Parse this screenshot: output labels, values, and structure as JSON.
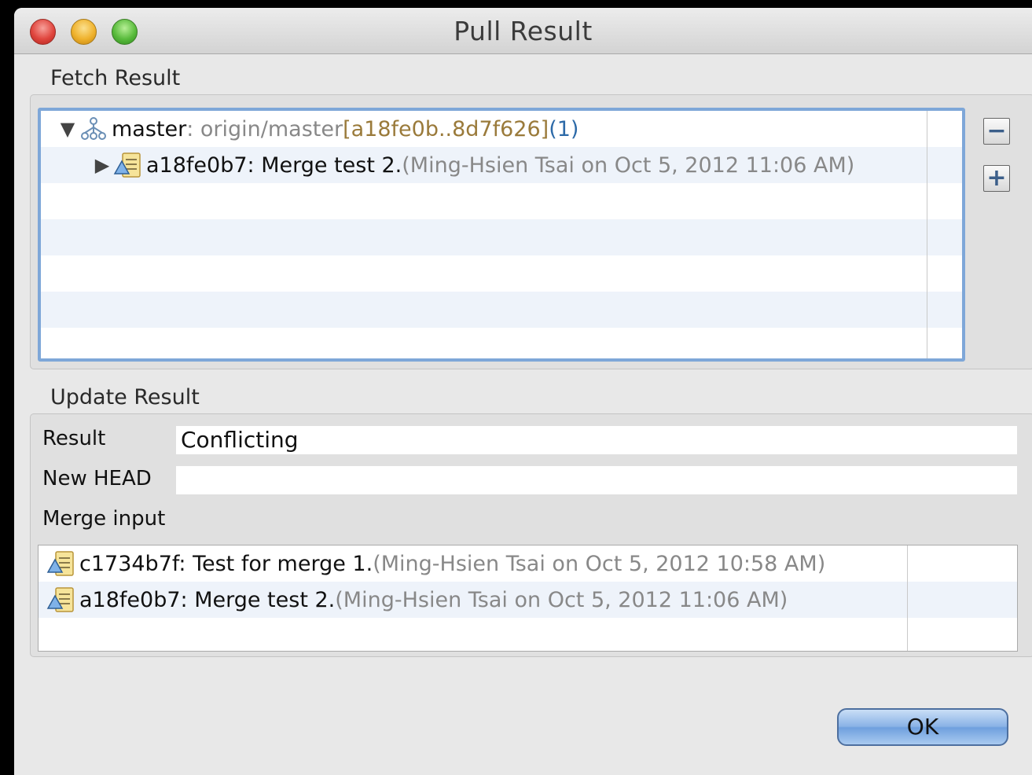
{
  "window": {
    "title": "Pull Result"
  },
  "fetch_result": {
    "label": "Fetch Result",
    "root": {
      "name": "master",
      "sep": " : origin/master ",
      "range": "[a18fe0b..8d7f626]",
      "count": " (1)"
    },
    "commit": {
      "id_msg": "a18fe0b7: Merge test 2.",
      "meta": " (Ming-Hsien Tsai on Oct 5, 2012 11:06 AM)"
    }
  },
  "update_result": {
    "label": "Update Result",
    "result_label": "Result",
    "result_value": "Conflicting",
    "new_head_label": "New HEAD",
    "new_head_value": "",
    "merge_input_label": "Merge input",
    "merge_inputs": [
      {
        "id_msg": "c1734b7f: Test for merge 1.",
        "meta": " (Ming-Hsien Tsai on Oct 5, 2012 10:58 AM)"
      },
      {
        "id_msg": "a18fe0b7: Merge test 2.",
        "meta": " (Ming-Hsien Tsai on Oct 5, 2012 11:06 AM)"
      }
    ]
  },
  "buttons": {
    "ok": "OK",
    "collapse": "−",
    "expand": "+"
  },
  "colors": {
    "selection_border": "#7ea7d8",
    "accent": "#2d6aa8",
    "range": "#9a7a3a"
  }
}
